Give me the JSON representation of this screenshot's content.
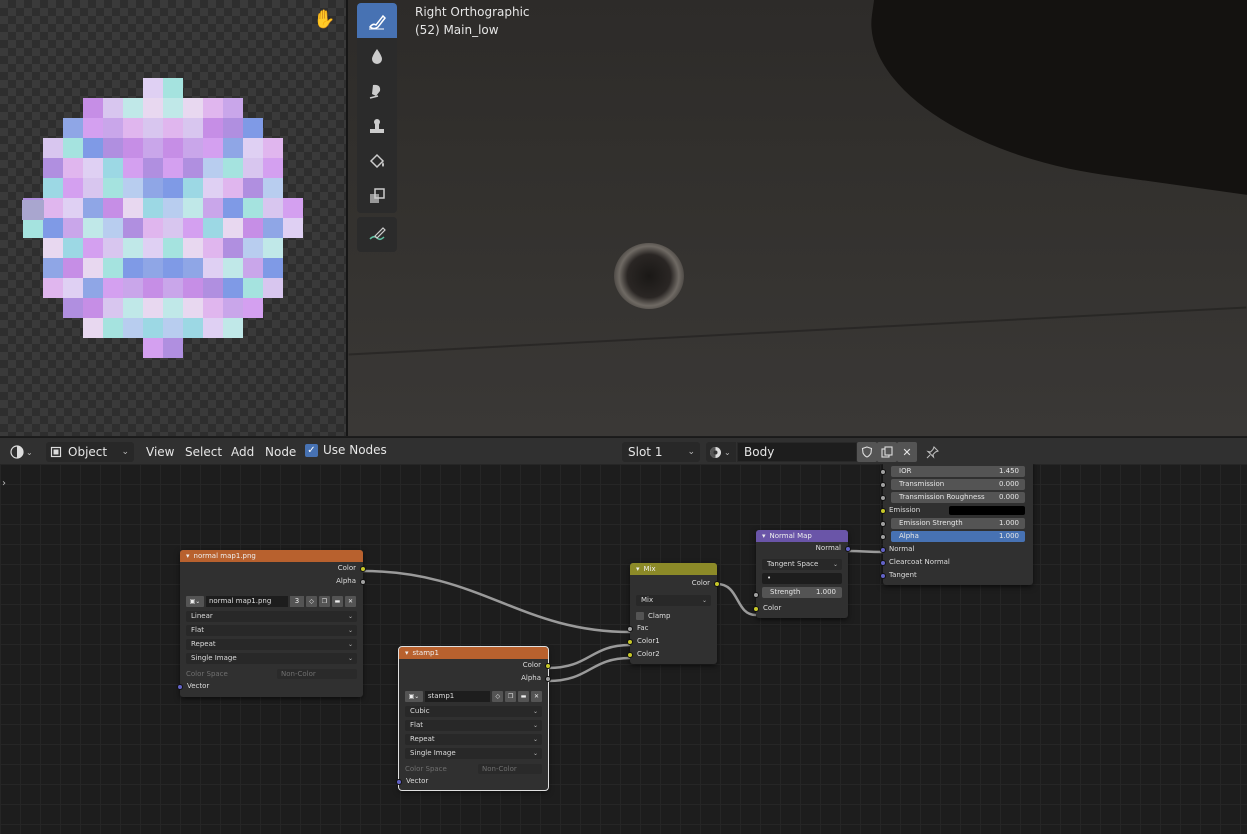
{
  "viewport": {
    "view_name": "Right Orthographic",
    "object_info": "(52) Main_low",
    "tools": [
      "draw-brush-icon",
      "soften-icon",
      "smear-icon",
      "clone-icon",
      "fill-icon",
      "mask-icon",
      "annotate-icon"
    ]
  },
  "image_editor": {
    "hand_icon": "hand-icon"
  },
  "node_header": {
    "mode_label": "Object",
    "menus": [
      "View",
      "Select",
      "Add",
      "Node"
    ],
    "use_nodes_label": "Use Nodes",
    "use_nodes_checked": true,
    "slot_label": "Slot 1",
    "material_name": "Body"
  },
  "nodes": {
    "normal_map_tex": {
      "title": "normal map1.png",
      "out_color": "Color",
      "out_alpha": "Alpha",
      "image_name": "normal map1.png",
      "users": "3",
      "interpolation": "Linear",
      "projection": "Flat",
      "extension": "Repeat",
      "source": "Single Image",
      "color_space_label": "Color Space",
      "color_space_value": "Non-Color",
      "in_vector": "Vector"
    },
    "stamp_tex": {
      "title": "stamp1",
      "out_color": "Color",
      "out_alpha": "Alpha",
      "image_name": "stamp1",
      "interpolation": "Cubic",
      "projection": "Flat",
      "extension": "Repeat",
      "source": "Single Image",
      "color_space_label": "Color Space",
      "color_space_value": "Non-Color",
      "in_vector": "Vector"
    },
    "mix": {
      "title": "Mix",
      "out_color": "Color",
      "blend_mode": "Mix",
      "clamp_label": "Clamp",
      "in_fac": "Fac",
      "in_color1": "Color1",
      "in_color2": "Color2"
    },
    "normal_map": {
      "title": "Normal Map",
      "out_normal": "Normal",
      "space": "Tangent Space",
      "uv_value": "•",
      "strength_label": "Strength",
      "strength_value": "1.000",
      "in_color": "Color"
    },
    "bsdf": {
      "ior_label": "IOR",
      "ior_value": "1.450",
      "transmission_label": "Transmission",
      "transmission_value": "0.000",
      "trans_rough_label": "Transmission Roughness",
      "trans_rough_value": "0.000",
      "emission_label": "Emission",
      "emission_strength_label": "Emission Strength",
      "emission_strength_value": "1.000",
      "alpha_label": "Alpha",
      "alpha_value": "1.000",
      "normal_label": "Normal",
      "clearcoat_normal_label": "Clearcoat Normal",
      "tangent_label": "Tangent"
    }
  },
  "colors": {
    "accent": "#4772b3",
    "texture_header": "#b8612e",
    "color_header": "#8c8a28",
    "vector_header": "#6a55a8",
    "socket_color": "#c7c729",
    "socket_float": "#a1a1a1",
    "socket_vector": "#6363c7"
  }
}
